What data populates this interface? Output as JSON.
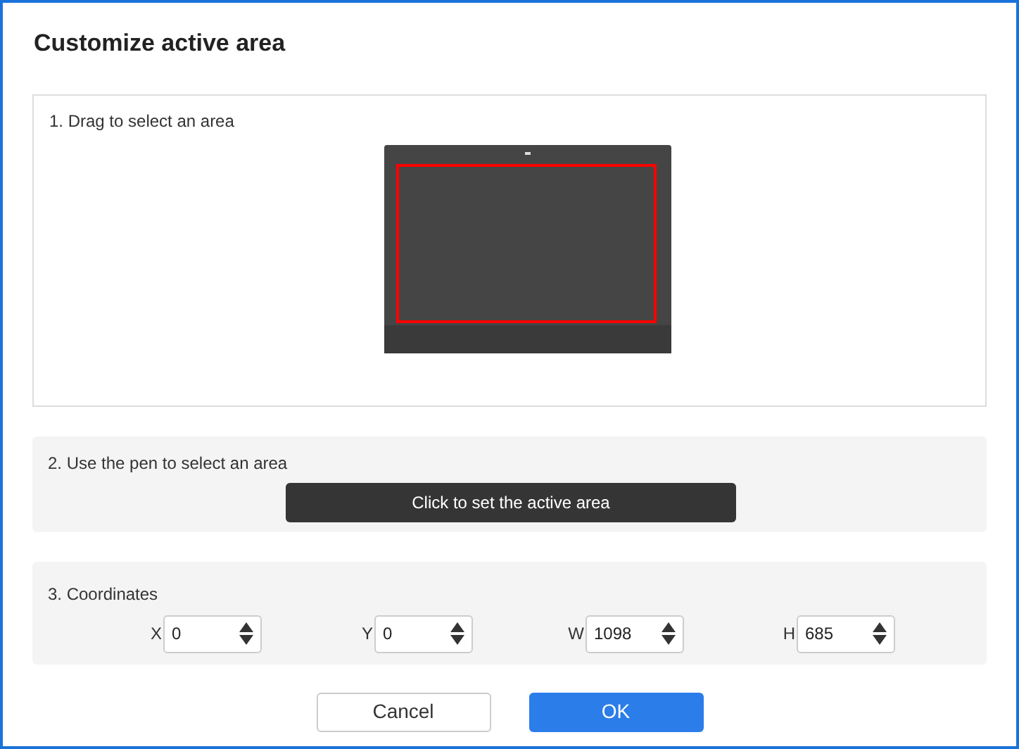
{
  "window": {
    "title": "Customize active area"
  },
  "section_1": {
    "label": "1. Drag to select an area"
  },
  "section_2": {
    "label": "2. Use the pen to select an area",
    "button": "Click to set the active area"
  },
  "section_3": {
    "label": "3. Coordinates",
    "fields": [
      {
        "label": "X",
        "value": "0"
      },
      {
        "label": "Y",
        "value": "0"
      },
      {
        "label": "W",
        "value": "1098"
      },
      {
        "label": "H",
        "value": "685"
      }
    ]
  },
  "buttons": [
    {
      "label": "Cancel",
      "kind": "secondary"
    },
    {
      "label": "OK",
      "kind": "primary"
    }
  ]
}
